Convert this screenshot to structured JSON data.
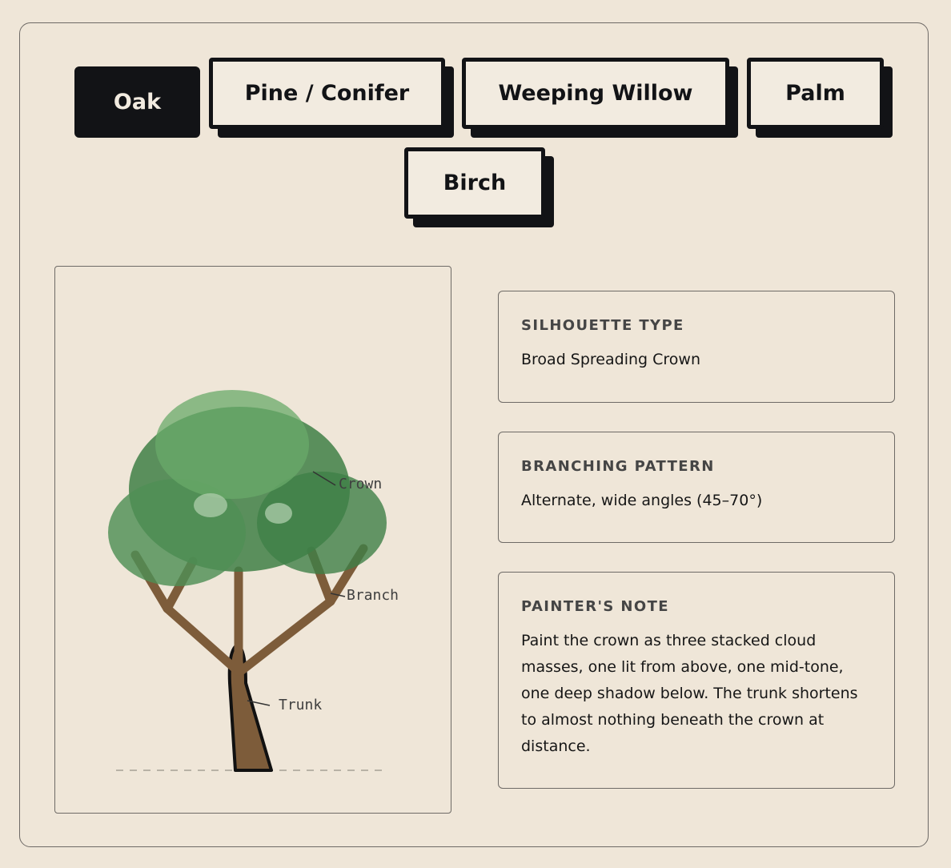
{
  "tabs": [
    {
      "label": "Oak",
      "active": true
    },
    {
      "label": "Pine / Conifer",
      "active": false
    },
    {
      "label": "Weeping Willow",
      "active": false
    },
    {
      "label": "Palm",
      "active": false
    },
    {
      "label": "Birch",
      "active": false
    }
  ],
  "illustration": {
    "labels": {
      "crown": "Crown",
      "branch": "Branch",
      "trunk": "Trunk"
    },
    "colors": {
      "crown_light": "#8cbf8c",
      "crown_mid": "#5f9f5f",
      "crown_dark": "#3f7f47",
      "wood": "#7d5c3a",
      "outline": "#111111"
    }
  },
  "details": [
    {
      "heading": "SILHOUETTE TYPE",
      "value": "Broad Spreading Crown"
    },
    {
      "heading": "BRANCHING PATTERN",
      "value": "Alternate, wide angles (45–70°)"
    },
    {
      "heading": "PAINTER'S NOTE",
      "value": "Paint the crown as three stacked cloud masses, one lit from above, one mid-tone, one deep shadow below. The trunk shortens to almost nothing beneath the crown at distance."
    }
  ]
}
